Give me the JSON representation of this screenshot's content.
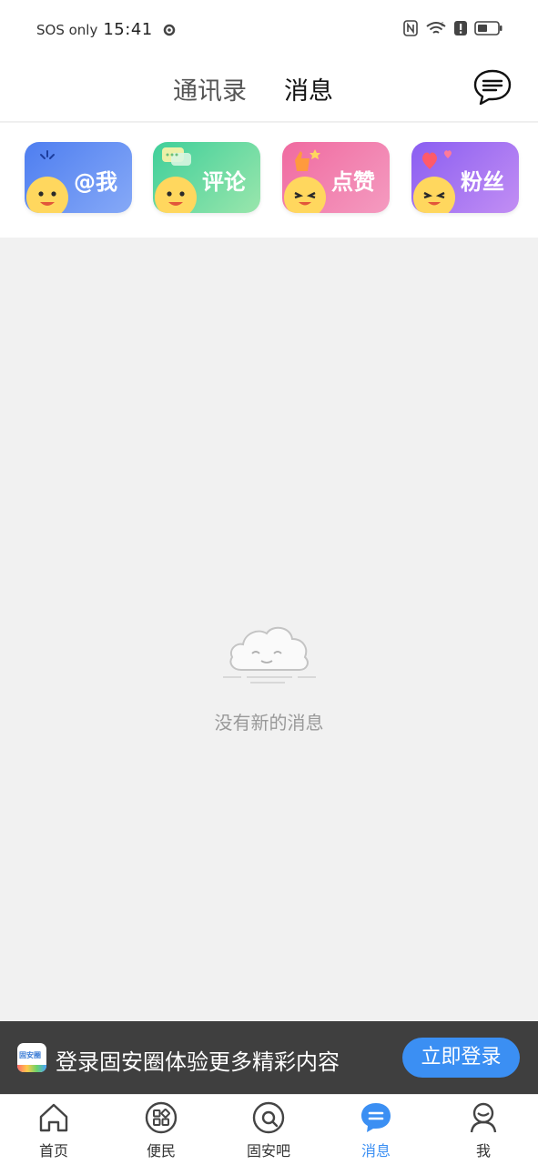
{
  "status": {
    "carrier": "SOS only",
    "time": "15:41",
    "network": "6"
  },
  "header": {
    "tabs": [
      {
        "label": "通讯录"
      },
      {
        "label": "消息"
      }
    ]
  },
  "cards": [
    {
      "label": "@我"
    },
    {
      "label": "评论"
    },
    {
      "label": "点赞"
    },
    {
      "label": "粉丝"
    }
  ],
  "empty": {
    "text": "没有新的消息"
  },
  "banner": {
    "app_icon_text": "固安圈",
    "text": "登录固安圈体验更多精彩内容",
    "button": "立即登录"
  },
  "nav": [
    {
      "label": "首页",
      "icon": "home-icon"
    },
    {
      "label": "便民",
      "icon": "grid-icon"
    },
    {
      "label": "固安吧",
      "icon": "forum-icon"
    },
    {
      "label": "消息",
      "icon": "message-icon"
    },
    {
      "label": "我",
      "icon": "profile-icon"
    }
  ],
  "colors": {
    "accent": "#3b8ff3",
    "banner_bg": "#3f3f3f"
  }
}
